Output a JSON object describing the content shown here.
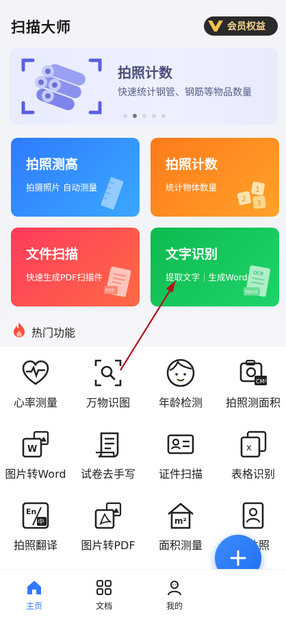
{
  "app_title": "扫描大师",
  "vip": {
    "label": "会员权益"
  },
  "banner": {
    "title": "拍照计数",
    "subtitle": "快速统计钢管、钢筋等物品数量",
    "page_count": 5,
    "active_index": 1
  },
  "cards": [
    {
      "title": "拍照测高",
      "subtitle": "拍摄照片 自动测量",
      "icon": "ruler-icon",
      "color": "#2f7bff"
    },
    {
      "title": "拍照计数",
      "subtitle": "统计物体数量",
      "icon": "number-blocks-icon",
      "color": "#ff7a1a"
    },
    {
      "title": "文件扫描",
      "subtitle": "快速生成PDF扫描件",
      "icon": "pdf-doc-icon",
      "color": "#ff3b5c"
    },
    {
      "title": "文字识别",
      "subtitle": "提取文字｜生成Word",
      "icon": "ocr-doc-icon",
      "color": "#0dbb4e"
    }
  ],
  "hot": {
    "title": "热门功能",
    "items": [
      {
        "label": "心率测量",
        "icon": "heart-rate-icon"
      },
      {
        "label": "万物识图",
        "icon": "image-search-icon"
      },
      {
        "label": "年龄检测",
        "icon": "face-icon"
      },
      {
        "label": "拍照测面积",
        "icon": "camera-area-icon"
      },
      {
        "label": "图片转Word",
        "icon": "image-to-word-icon"
      },
      {
        "label": "试卷去手写",
        "icon": "paper-scroll-icon"
      },
      {
        "label": "证件扫描",
        "icon": "id-card-icon"
      },
      {
        "label": "表格识别",
        "icon": "table-x-icon"
      },
      {
        "label": "拍照翻译",
        "icon": "translate-icon"
      },
      {
        "label": "图片转PDF",
        "icon": "image-to-pdf-icon"
      },
      {
        "label": "面积测量",
        "icon": "house-area-icon"
      },
      {
        "label": "证件照",
        "icon": "id-photo-icon"
      }
    ]
  },
  "nav": [
    {
      "label": "主页",
      "icon": "home-icon",
      "active": true
    },
    {
      "label": "文档",
      "icon": "grid-icon",
      "active": false
    },
    {
      "label": "我的",
      "icon": "profile-icon",
      "active": false
    }
  ],
  "colors": {
    "accent": "#2f7bff",
    "annotation": "#b3121a"
  }
}
